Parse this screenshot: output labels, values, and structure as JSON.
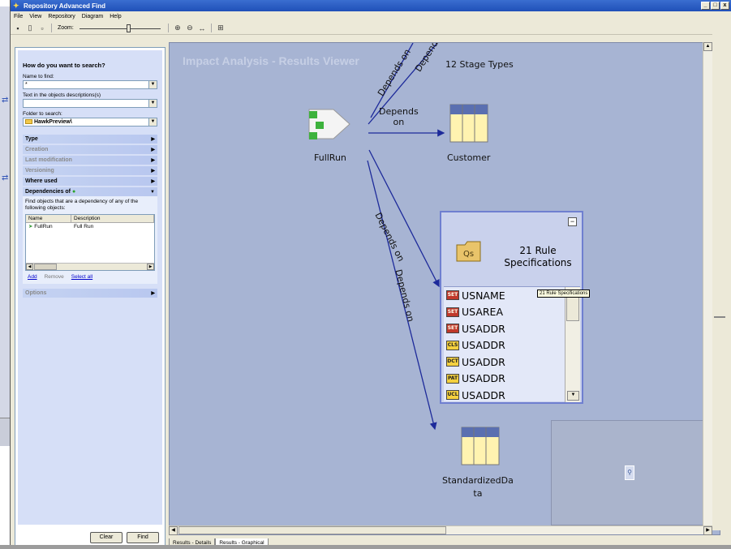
{
  "window": {
    "title": "Repository Advanced Find",
    "controls": [
      "_",
      "□",
      "x"
    ]
  },
  "menu": [
    "File",
    "View",
    "Repository",
    "Diagram",
    "Help"
  ],
  "toolbar": {
    "zoom_label": "Zoom:"
  },
  "search": {
    "heading": "How do you want to search?",
    "name_label": "Name to find:",
    "name_value": "*",
    "desc_label": "Text in the objects descriptions(s)",
    "desc_value": "",
    "folder_label": "Folder to search:",
    "folder_value": "HawkPreview\\",
    "sections": [
      {
        "label": "Type",
        "disabled": false
      },
      {
        "label": "Creation",
        "disabled": true
      },
      {
        "label": "Last modification",
        "disabled": true
      },
      {
        "label": "Versioning",
        "disabled": true
      },
      {
        "label": "Where used",
        "disabled": false
      }
    ],
    "dependencies": {
      "label": "Dependencies of",
      "description": "Find objects that are a dependency of any of the following objects:",
      "col_name": "Name",
      "col_desc": "Description",
      "row_name": "FullRun",
      "row_desc": "Full Run",
      "add": "Add",
      "remove": "Remove",
      "select_all": "Select all"
    },
    "options_label": "Options",
    "clear_button": "Clear",
    "find_button": "Find"
  },
  "canvas": {
    "title": "Impact Analysis - Results Viewer",
    "nodes": {
      "fullrun": "FullRun",
      "stage_types": "12 Stage Types",
      "customer": "Customer",
      "standardized_line1": "StandardizedDa",
      "standardized_line2": "ta"
    },
    "edge_labels": {
      "top_a": "Depends on",
      "top_b": "Depends on",
      "customer_line1": "Depends",
      "customer_line2": "on",
      "rules": "Depends on",
      "standardized": "Depends on"
    },
    "group": {
      "title": "21 Rule Specifications",
      "items": [
        {
          "icon": "SET",
          "color": "red",
          "label": "USNAME"
        },
        {
          "icon": "SET",
          "color": "red",
          "label": "USAREA"
        },
        {
          "icon": "SET",
          "color": "red",
          "label": "USADDR"
        },
        {
          "icon": "CLS",
          "color": "yel",
          "label": "USADDR"
        },
        {
          "icon": "DCT",
          "color": "yel",
          "label": "USADDR"
        },
        {
          "icon": "PAT",
          "color": "yel",
          "label": "USADDR"
        },
        {
          "icon": "UCL",
          "color": "yel",
          "label": "USADDR"
        }
      ],
      "tooltip": "21 Rule Specifications"
    }
  },
  "tabs": [
    "Results - Details",
    "Results - Graphical"
  ]
}
